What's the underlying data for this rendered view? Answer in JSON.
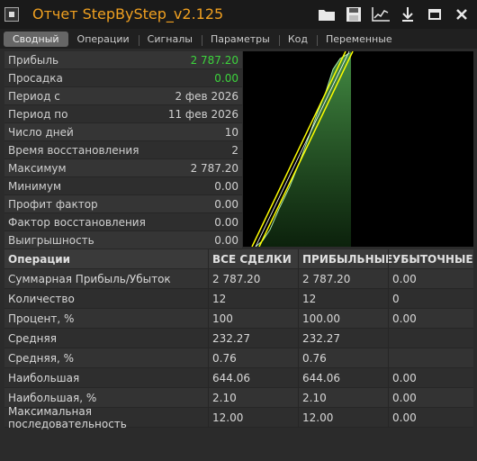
{
  "title": "Отчет StepByStep_v2.125",
  "toolbar_icons": [
    "folder-icon",
    "save-icon",
    "chart-icon",
    "download-icon",
    "maximize-icon",
    "close-icon"
  ],
  "tabs": [
    "Сводный",
    "Операции",
    "Сигналы",
    "Параметры",
    "Код",
    "Переменные"
  ],
  "active_tab": "Сводный",
  "summary": [
    {
      "label": "Прибыль",
      "value": "2 787.20",
      "color": "#3cd43c"
    },
    {
      "label": "Просадка",
      "value": "0.00",
      "color": "#3cd43c"
    },
    {
      "label": "Период с",
      "value": "2 фев 2026"
    },
    {
      "label": "Период по",
      "value": "11 фев 2026"
    },
    {
      "label": "Число дней",
      "value": "10"
    },
    {
      "label": "Время восстановления",
      "value": "2"
    },
    {
      "label": "Максимум",
      "value": "2 787.20"
    },
    {
      "label": "Минимум",
      "value": "0.00"
    },
    {
      "label": "Профит фактор",
      "value": "0.00"
    },
    {
      "label": "Фактор восстановления",
      "value": "0.00"
    },
    {
      "label": "Выигрышность",
      "value": "0.00"
    }
  ],
  "stats": {
    "headers": [
      "Операции",
      "ВСЕ СДЕЛКИ",
      "ПРИБЫЛЬНЫЕ",
      "УБЫТОЧНЫЕ"
    ],
    "rows": [
      [
        "Суммарная Прибыль/Убыток",
        "2 787.20",
        "2 787.20",
        "0.00"
      ],
      [
        "Количество",
        "12",
        "12",
        "0"
      ],
      [
        "Процент, %",
        "100",
        "100.00",
        "0.00"
      ],
      [
        "Средняя",
        "232.27",
        "232.27",
        ""
      ],
      [
        "Средняя, %",
        "0.76",
        "0.76",
        ""
      ],
      [
        "Наибольшая",
        "644.06",
        "644.06",
        "0.00"
      ],
      [
        "Наибольшая, %",
        "2.10",
        "2.10",
        "0.00"
      ],
      [
        "Максимальная последовательность",
        "12.00",
        "12.00",
        "0.00"
      ]
    ]
  },
  "colors": {
    "accent_title": "#f0a020",
    "profit_green": "#3cd43c",
    "line_yellow": "#ffff00"
  }
}
